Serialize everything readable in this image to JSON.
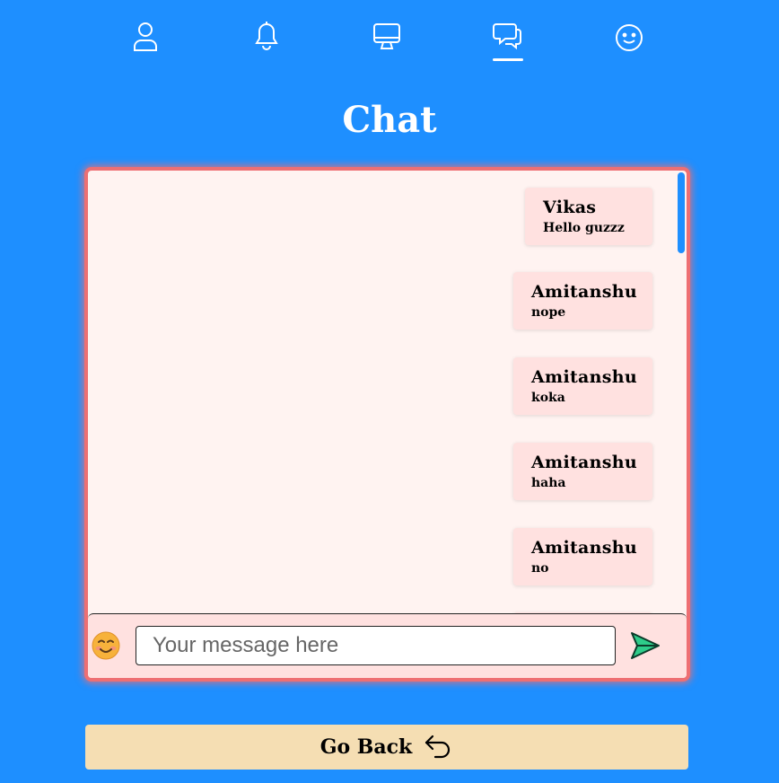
{
  "nav": {
    "items": [
      {
        "icon": "user-icon",
        "active": false
      },
      {
        "icon": "bell-icon",
        "active": false
      },
      {
        "icon": "monitor-icon",
        "active": false
      },
      {
        "icon": "chat-icon",
        "active": true
      },
      {
        "icon": "smiley-icon",
        "active": false
      }
    ]
  },
  "page": {
    "title": "Chat"
  },
  "messages": [
    {
      "author": "Vikas",
      "text": "Hello guzzz"
    },
    {
      "author": "Amitanshu",
      "text": "nope"
    },
    {
      "author": "Amitanshu",
      "text": "koka"
    },
    {
      "author": "Amitanshu",
      "text": "haha"
    },
    {
      "author": "Amitanshu",
      "text": "no"
    }
  ],
  "composer": {
    "placeholder": "Your message here",
    "value": "",
    "emoji_icon": "smiling-face-emoji-icon",
    "send_icon": "send-arrow-icon"
  },
  "footer": {
    "go_back_label": "Go Back",
    "go_back_icon": "undo-arrow-icon"
  },
  "colors": {
    "background": "#1e8fff",
    "chat_border": "#ee6f73",
    "chat_bg": "#fff3f1",
    "bubble_bg": "#ffe1e0",
    "go_back_bg": "#f5deb3",
    "send_icon": "#2ecc8a"
  }
}
